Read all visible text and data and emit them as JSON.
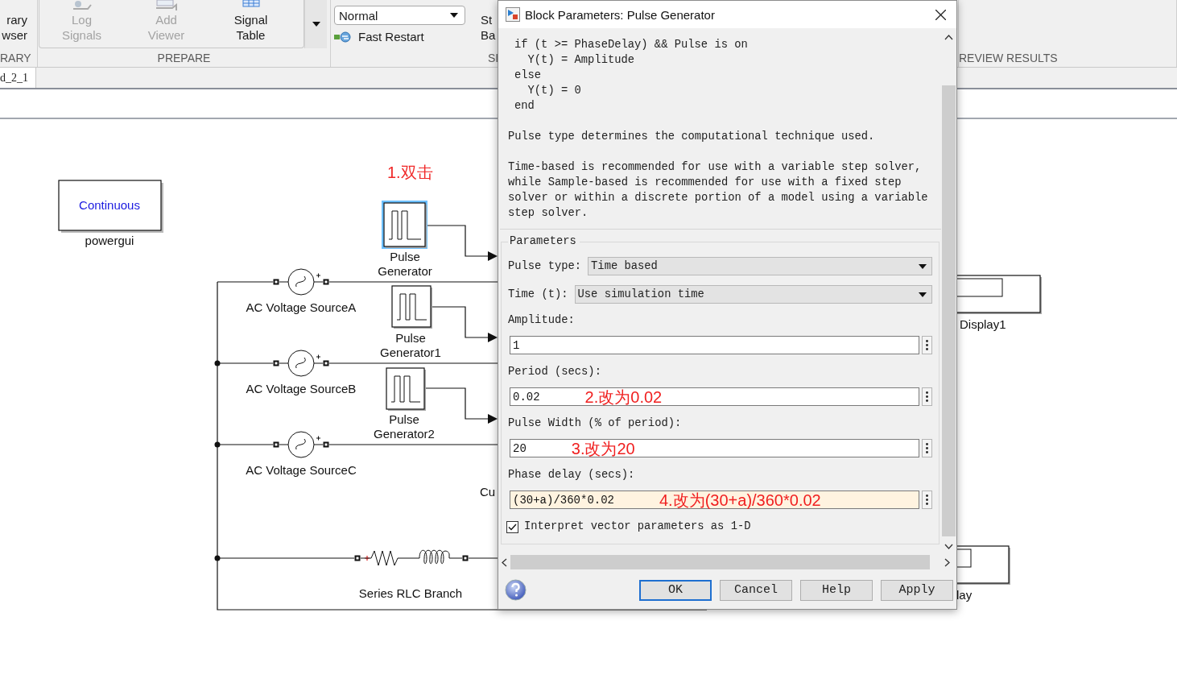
{
  "toolstrip": {
    "sections": [
      {
        "kind": "cut",
        "label": "RARY",
        "buttons": [
          {
            "lines": [
              "rary",
              "wser"
            ],
            "disabled": false
          }
        ]
      },
      {
        "kind": "gallery",
        "label": "PREPARE",
        "buttons": [
          {
            "lines": [
              "Log",
              "Signals"
            ],
            "disabled": true
          },
          {
            "lines": [
              "Add",
              "Viewer"
            ],
            "disabled": true
          },
          {
            "lines": [
              "Signal",
              "Table"
            ],
            "disabled": false
          }
        ]
      },
      {
        "kind": "simulate",
        "label": "SI",
        "mode": "Normal",
        "fast_restart": "Fast Restart",
        "buttons": [
          {
            "lines": [
              "St",
              "Ba"
            ],
            "disabled": false
          }
        ]
      },
      {
        "kind": "review",
        "label": "REVIEW RESULTS"
      }
    ]
  },
  "model_tab": {
    "label": "d_2_1"
  },
  "diagram": {
    "annotation": "1.双击",
    "powergui": {
      "text": "Continuous",
      "label": "powergui"
    },
    "pulse_generators": [
      {
        "label": [
          "Pulse",
          "Generator"
        ],
        "selected": true
      },
      {
        "label": [
          "Pulse",
          "Generator1"
        ],
        "selected": false
      },
      {
        "label": [
          "Pulse",
          "Generator2"
        ],
        "selected": false
      }
    ],
    "ac_sources": [
      {
        "label": "AC Voltage SourceA"
      },
      {
        "label": "AC Voltage SourceB"
      },
      {
        "label": "AC Voltage SourceC"
      }
    ],
    "rlc_branch": {
      "label": "Series RLC Branch"
    },
    "cut_label": "Cu",
    "displays": [
      {
        "label": "Display1"
      },
      {
        "label": "lay"
      }
    ]
  },
  "dialog": {
    "title": "Block Parameters: Pulse Generator",
    "code": [
      "if (t >= PhaseDelay) && Pulse is on",
      "  Y(t) = Amplitude",
      "else",
      "  Y(t) = 0",
      "end"
    ],
    "paragraphs": [
      "Pulse type determines the computational technique used.",
      "Time-based is recommended for use with a variable step solver, while Sample-based is recommended for use with a fixed step solver or within a discrete portion of a model using a variable step solver."
    ],
    "group_label": "Parameters",
    "fields": [
      {
        "kind": "select",
        "label": "Pulse type:",
        "value": "Time based"
      },
      {
        "kind": "select",
        "label": "Time (t):",
        "value": "Use simulation time"
      },
      {
        "kind": "input",
        "label": "Amplitude:",
        "value": "1",
        "focused": false
      },
      {
        "kind": "input",
        "label": "Period (secs):",
        "value": "0.02",
        "focused": false,
        "annotation": "2.改为0.02"
      },
      {
        "kind": "input",
        "label": "Pulse Width (% of period):",
        "value": "20",
        "focused": false,
        "annotation": "3.改为20"
      },
      {
        "kind": "input",
        "label": "Phase delay (secs):",
        "value": "(30+a)/360*0.02",
        "focused": true,
        "annotation": "4.改为(30+a)/360*0.02"
      }
    ],
    "checkbox": {
      "label": "Interpret vector parameters as 1-D",
      "checked": true
    },
    "buttons": [
      {
        "label": "OK",
        "default": true
      },
      {
        "label": "Cancel",
        "default": false
      },
      {
        "label": "Help",
        "default": false
      },
      {
        "label": "Apply",
        "default": false
      }
    ]
  }
}
